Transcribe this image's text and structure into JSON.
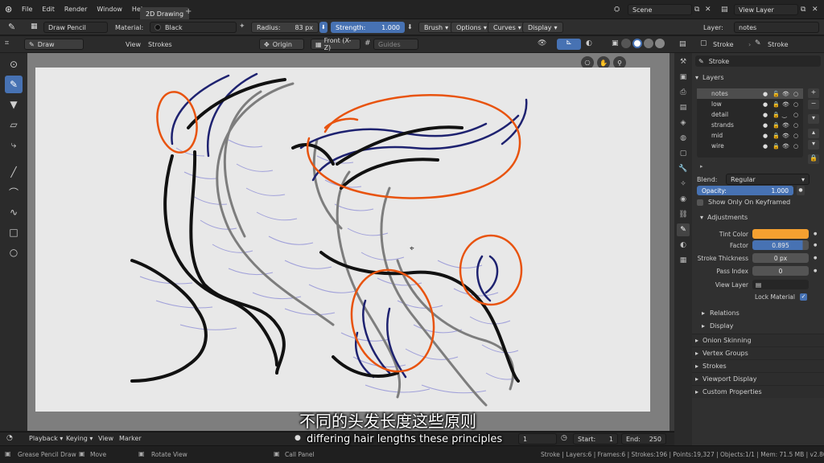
{
  "menubar": {
    "items": [
      "File",
      "Edit",
      "Render",
      "Window",
      "Help"
    ],
    "workspace_tab": "2D Drawing",
    "add_tab": "+",
    "scene": "Scene",
    "view_layer": "View Layer"
  },
  "toolheader": {
    "tool_name": "Draw Pencil",
    "material_label": "Material:",
    "material_value": "Black",
    "radius_label": "Radius:",
    "radius_value": "83 px",
    "strength_label": "Strength:",
    "strength_value": "1.000",
    "brush": "Brush",
    "options": "Options",
    "curves": "Curves",
    "display": "Display",
    "layer_label": "Layer:",
    "layer_value": "notes"
  },
  "viewport_header": {
    "mode": "Draw",
    "view": "View",
    "strokes": "Strokes",
    "origin": "Origin",
    "plane": "Front (X-Z)",
    "guides": "Guides"
  },
  "timeline": {
    "playback": "Playback",
    "keying": "Keying",
    "view": "View",
    "marker": "Marker",
    "current_frame": "1",
    "start_label": "Start:",
    "start_value": "1",
    "end_label": "End:",
    "end_value": "250"
  },
  "statusbar": {
    "left1": "Grease Pencil Draw",
    "left2": "Move",
    "left3": "Rotate View",
    "left4": "Call Panel",
    "stats": "Stroke | Layers:6 | Frames:6 | Strokes:196 | Points:19,327 | Objects:1/1 | Mem: 71.5 MB | v2.80.57"
  },
  "properties": {
    "header_stroke1": "Stroke",
    "header_stroke2": "Stroke",
    "object_name": "Stroke",
    "layers_title": "Layers",
    "layers": [
      "notes",
      "low",
      "detail",
      "strands",
      "mid",
      "wire"
    ],
    "blend_label": "Blend:",
    "blend_value": "Regular",
    "opacity_label": "Opacity:",
    "opacity_value": "1.000",
    "show_only_keyframed": "Show Only On Keyframed",
    "adjustments_title": "Adjustments",
    "tint_color_label": "Tint Color",
    "tint_color": "#f5a030",
    "factor_label": "Factor",
    "factor_value": "0.895",
    "stroke_thickness_label": "Stroke Thickness",
    "stroke_thickness_value": "0 px",
    "pass_index_label": "Pass Index",
    "pass_index_value": "0",
    "view_layer_label": "View Layer",
    "lock_material_label": "Lock Material",
    "relations": "Relations",
    "display": "Display",
    "sections": [
      "Onion Skinning",
      "Vertex Groups",
      "Strokes",
      "Viewport Display",
      "Custom Properties"
    ]
  },
  "subtitles": {
    "chinese": "不同的头发长度这些原则",
    "english": "differing hair lengths these principles"
  },
  "colors": {
    "accent_blue": "#4772b3",
    "orange_stroke": "#e8530e",
    "navy_stroke": "#1e2270",
    "gray_stroke": "#7a7a7a",
    "guide_lines": "#8a8ad0"
  }
}
